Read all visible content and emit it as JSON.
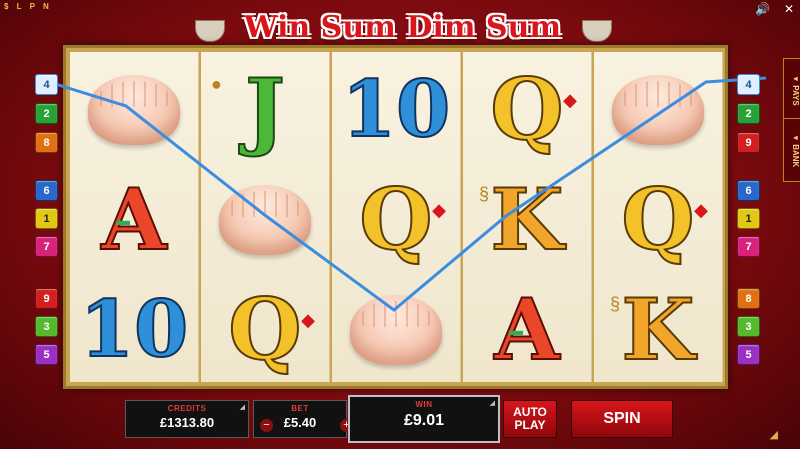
{
  "corner": {
    "logo": "$ L P N",
    "sound_icon": "speaker-icon",
    "close_icon": "close-icon"
  },
  "title": "Win Sum Dim Sum",
  "reels": [
    [
      "dumpling",
      "A",
      "10"
    ],
    [
      "J",
      "dumpling",
      "Q"
    ],
    [
      "10",
      "Q",
      "dumpling"
    ],
    [
      "Q",
      "K",
      "A"
    ],
    [
      "dumpling",
      "Q",
      "K"
    ]
  ],
  "paylines": {
    "left": [
      [
        "4",
        "blue",
        true
      ],
      [
        "2",
        "green",
        false
      ],
      [
        "8",
        "orange",
        false
      ],
      [
        "6",
        "blue",
        false
      ],
      [
        "1",
        "yellow",
        false
      ],
      [
        "7",
        "pink",
        false
      ],
      [
        "9",
        "red",
        false
      ],
      [
        "3",
        "lime",
        false
      ],
      [
        "5",
        "purple",
        false
      ]
    ],
    "right": [
      [
        "4",
        "blue",
        true
      ],
      [
        "2",
        "green",
        false
      ],
      [
        "9",
        "red",
        false
      ],
      [
        "6",
        "blue",
        false
      ],
      [
        "1",
        "yellow",
        false
      ],
      [
        "7",
        "pink",
        false
      ],
      [
        "8",
        "orange",
        false
      ],
      [
        "3",
        "lime",
        false
      ],
      [
        "5",
        "purple",
        false
      ]
    ]
  },
  "side_tabs": {
    "pays": "◂ PAYS",
    "bank": "◂ BANK"
  },
  "panel": {
    "credits_label": "CREDITS",
    "credits_value": "£1313.80",
    "bet_label": "BET",
    "bet_value": "£5.40",
    "bet_minus": "−",
    "bet_plus": "+",
    "win_label": "WIN",
    "win_value": "£9.01",
    "autoplay": "AUTO PLAY",
    "spin": "SPIN"
  },
  "colors": {
    "blue": "#2a67c8",
    "green": "#29a137",
    "orange": "#e07012",
    "yellow": "#e2c814",
    "pink": "#d8227b",
    "red": "#d21f1f",
    "purple": "#9a2fc2",
    "lime": "#58b82b",
    "payline": "#3a8de0"
  }
}
